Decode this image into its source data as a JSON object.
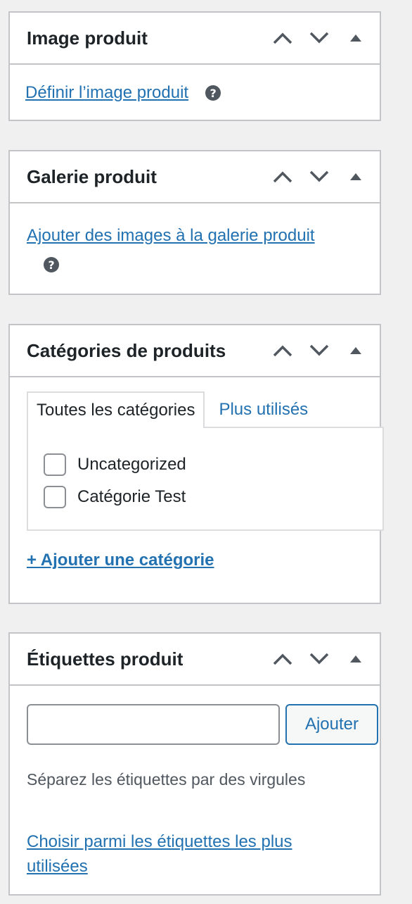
{
  "colors": {
    "link": "#2271b1",
    "border": "#c3c4c7",
    "background": "#f0f0f1",
    "text": "#1d2327",
    "muted": "#50575e"
  },
  "icons": {
    "move_up": "chevron-up-icon",
    "move_down": "chevron-down-icon",
    "toggle": "triangle-up-icon",
    "help": "question-circle-icon"
  },
  "image_box": {
    "title": "Image produit",
    "link": "Définir l’image produit",
    "help": "?"
  },
  "gallery_box": {
    "title": "Galerie produit",
    "link": "Ajouter des images à la galerie produit",
    "help": "?"
  },
  "categories_box": {
    "title": "Catégories de produits",
    "tabs": [
      "Toutes les catégories",
      "Plus utilisés"
    ],
    "items": [
      {
        "label": "Uncategorized",
        "checked": false
      },
      {
        "label": "Catégorie Test",
        "checked": false
      }
    ],
    "add_link": "+ Ajouter une catégorie"
  },
  "tags_box": {
    "title": "Étiquettes produit",
    "input_value": "",
    "add_button": "Ajouter",
    "hint": "Séparez les étiquettes par des virgules",
    "choose_link": "Choisir parmi les étiquettes les plus utilisées"
  }
}
